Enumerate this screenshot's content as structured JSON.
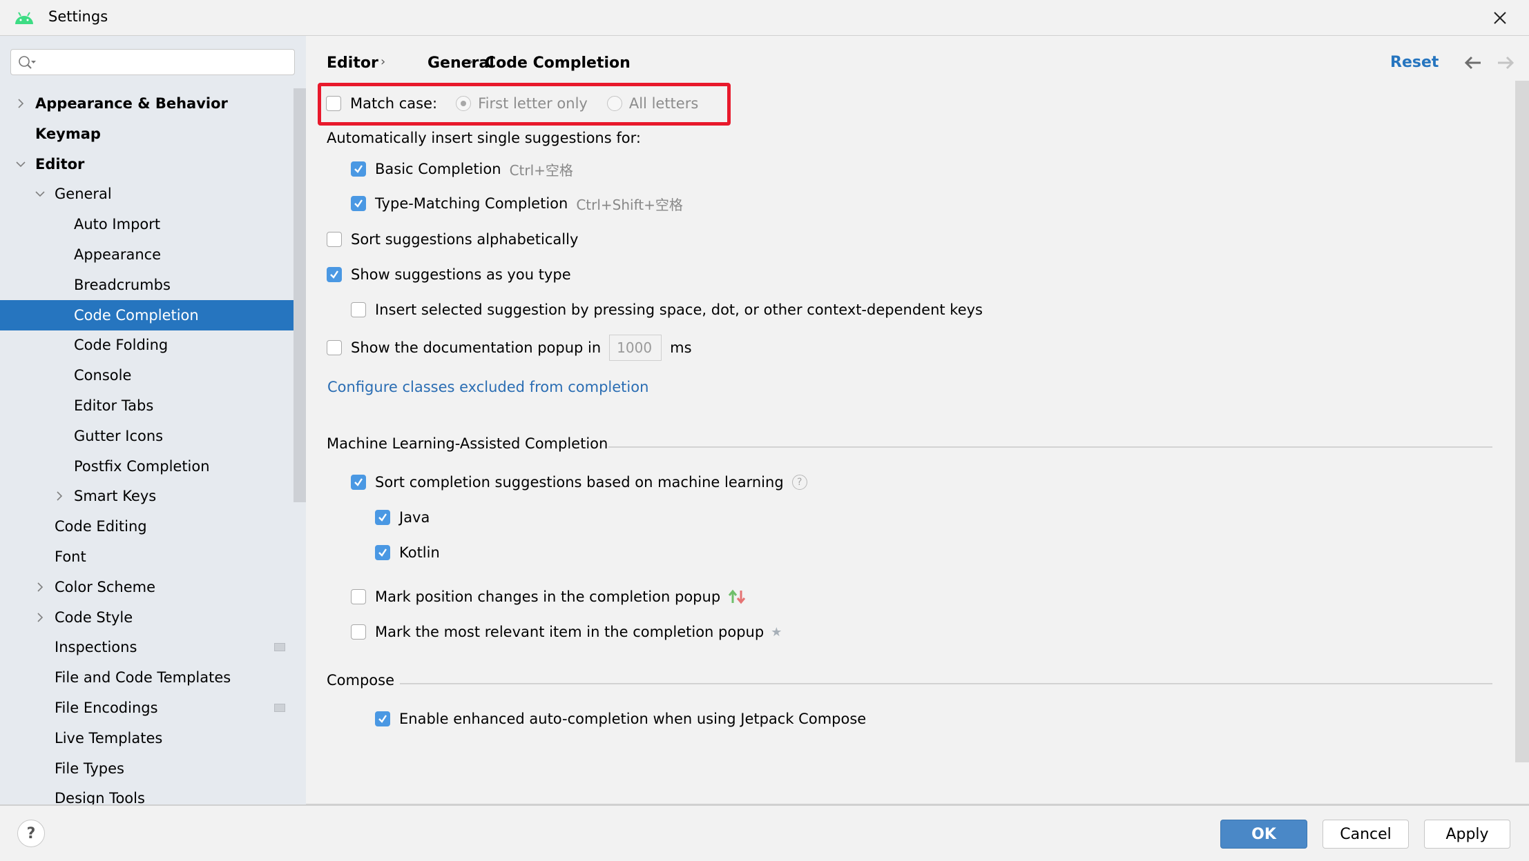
{
  "window": {
    "title": "Settings",
    "icons": {
      "app": "android-icon",
      "close": "close-icon"
    }
  },
  "sidebar": {
    "search": {
      "value": "",
      "placeholder": ""
    },
    "items": [
      {
        "label": "Appearance & Behavior",
        "level": 0,
        "expandable": true,
        "expanded": false,
        "bold": true
      },
      {
        "label": "Keymap",
        "level": 0,
        "expandable": false,
        "bold": true
      },
      {
        "label": "Editor",
        "level": 0,
        "expandable": true,
        "expanded": true,
        "bold": true
      },
      {
        "label": "General",
        "level": 1,
        "expandable": true,
        "expanded": true
      },
      {
        "label": "Auto Import",
        "level": 2
      },
      {
        "label": "Appearance",
        "level": 2
      },
      {
        "label": "Breadcrumbs",
        "level": 2
      },
      {
        "label": "Code Completion",
        "level": 2,
        "selected": true
      },
      {
        "label": "Code Folding",
        "level": 2
      },
      {
        "label": "Console",
        "level": 2
      },
      {
        "label": "Editor Tabs",
        "level": 2
      },
      {
        "label": "Gutter Icons",
        "level": 2
      },
      {
        "label": "Postfix Completion",
        "level": 2
      },
      {
        "label": "Smart Keys",
        "level": 2,
        "expandable": true,
        "expanded": false
      },
      {
        "label": "Code Editing",
        "level": 1
      },
      {
        "label": "Font",
        "level": 1
      },
      {
        "label": "Color Scheme",
        "level": 1,
        "expandable": true,
        "expanded": false
      },
      {
        "label": "Code Style",
        "level": 1,
        "expandable": true,
        "expanded": false
      },
      {
        "label": "Inspections",
        "level": 1,
        "project_badge": true
      },
      {
        "label": "File and Code Templates",
        "level": 1
      },
      {
        "label": "File Encodings",
        "level": 1,
        "project_badge": true
      },
      {
        "label": "Live Templates",
        "level": 1
      },
      {
        "label": "File Types",
        "level": 1
      },
      {
        "label": "Design Tools",
        "level": 1
      }
    ]
  },
  "header": {
    "breadcrumb": [
      "Editor",
      "General",
      "Code Completion"
    ],
    "reset_label": "Reset"
  },
  "content": {
    "match_case": {
      "label": "Match case:",
      "checked": false,
      "options": [
        {
          "label": "First letter only",
          "selected": true
        },
        {
          "label": "All letters",
          "selected": false
        }
      ]
    },
    "auto_insert_label": "Automatically insert single suggestions for:",
    "basic_completion": {
      "label": "Basic Completion",
      "shortcut": "Ctrl+空格",
      "checked": true
    },
    "type_matching": {
      "label": "Type-Matching Completion",
      "shortcut": "Ctrl+Shift+空格",
      "checked": true
    },
    "sort_alpha": {
      "label": "Sort suggestions alphabetically",
      "checked": false
    },
    "show_as_type": {
      "label": "Show suggestions as you type",
      "checked": true
    },
    "insert_selected": {
      "label": "Insert selected suggestion by pressing space, dot, or other context-dependent keys",
      "checked": false
    },
    "doc_popup": {
      "label": "Show the documentation popup in",
      "value": "1000",
      "unit": "ms",
      "checked": false
    },
    "configure_link": "Configure classes excluded from completion",
    "ml_section": {
      "title": "Machine Learning-Assisted Completion",
      "sort_ml": {
        "label": "Sort completion suggestions based on machine learning",
        "checked": true
      },
      "java": {
        "label": "Java",
        "checked": true
      },
      "kotlin": {
        "label": "Kotlin",
        "checked": true
      },
      "mark_position": {
        "label": "Mark position changes in the completion popup",
        "checked": false
      },
      "mark_relevant": {
        "label": "Mark the most relevant item in the completion popup",
        "checked": false
      }
    },
    "compose_section": {
      "title": "Compose",
      "enhanced": {
        "label": "Enable enhanced auto-completion when using Jetpack Compose",
        "checked": true
      }
    }
  },
  "footer": {
    "help": "?",
    "ok": "OK",
    "cancel": "Cancel",
    "apply": "Apply"
  },
  "colors": {
    "accent": "#2675bf",
    "checkbox_checked": "#4a98e3",
    "highlight_box": "#e8192c",
    "link": "#2a6db3",
    "arrow_up": "#6fbf6a",
    "arrow_down": "#e57373"
  }
}
